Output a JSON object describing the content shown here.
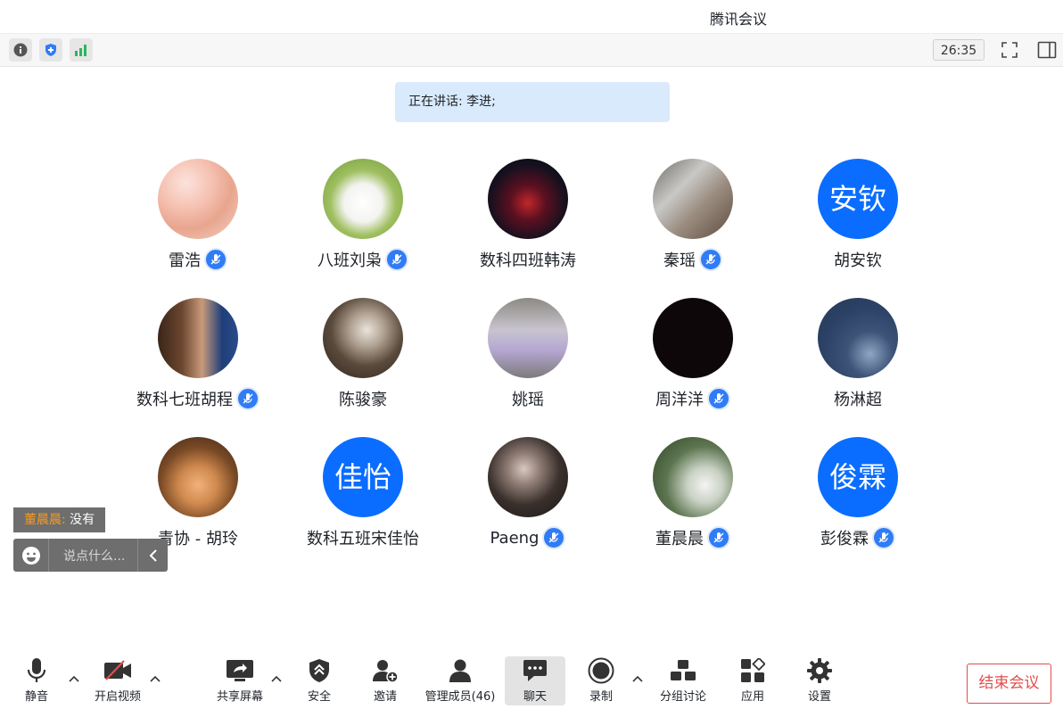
{
  "window": {
    "title": "腾讯会议"
  },
  "toolbar": {
    "timer": "26:35"
  },
  "speaking": {
    "text": "正在讲话: 李进;"
  },
  "participants": [
    {
      "name": "雷浩",
      "avatar": "photo",
      "muted": true
    },
    {
      "name": "八班刘枭",
      "avatar": "photo",
      "muted": true
    },
    {
      "name": "数科四班韩涛",
      "avatar": "photo",
      "muted": false
    },
    {
      "name": "秦瑶",
      "avatar": "photo",
      "muted": true
    },
    {
      "name": "胡安钦",
      "avatar_text": "安钦",
      "muted": false
    },
    {
      "name": "数科七班胡程",
      "avatar": "photo",
      "muted": true
    },
    {
      "name": "陈骏豪",
      "avatar": "photo",
      "muted": false
    },
    {
      "name": "姚瑶",
      "avatar": "photo",
      "muted": false
    },
    {
      "name": "周洋洋",
      "avatar": "photo",
      "muted": true
    },
    {
      "name": "杨淋超",
      "avatar": "photo",
      "muted": false
    },
    {
      "name": "青协 - 胡玲",
      "avatar": "photo",
      "muted": false
    },
    {
      "name": "数科五班宋佳怡",
      "avatar_text": "佳怡",
      "muted": false
    },
    {
      "name": "Paeng",
      "avatar": "photo",
      "muted": true
    },
    {
      "name": "董晨晨",
      "avatar": "photo",
      "muted": true
    },
    {
      "name": "彭俊霖",
      "avatar_text": "俊霖",
      "muted": true
    }
  ],
  "chat": {
    "last_sender": "董晨晨:",
    "last_message": "没有",
    "placeholder": "说点什么..."
  },
  "controls": {
    "mute": "静音",
    "video": "开启视频",
    "share": "共享屏幕",
    "security": "安全",
    "invite": "邀请",
    "members": "管理成员(46)",
    "chat": "聊天",
    "record": "录制",
    "breakout": "分组讨论",
    "apps": "应用",
    "settings": "设置",
    "end": "结束会议"
  },
  "colors": {
    "accent": "#0a6dff",
    "mic_badge": "#2f7cf6",
    "end": "#e34d4d",
    "signal": "#2db55d"
  }
}
